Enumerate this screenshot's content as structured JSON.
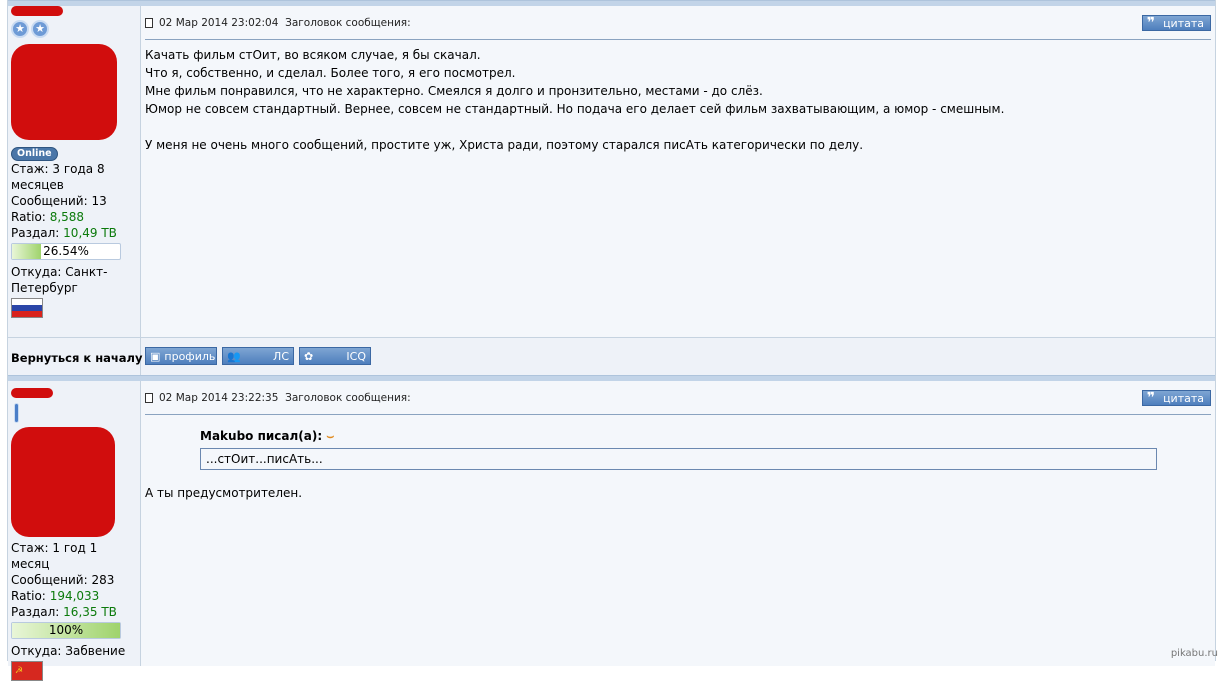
{
  "post1": {
    "author": {
      "online_label": "Online",
      "stats": {
        "tenure_label": "Стаж: 3 года 8",
        "tenure_cont": "месяцев",
        "messages_label": "Сообщений: 13",
        "ratio_label": "Ratio:",
        "ratio_value": "8,588",
        "upload_label": "Раздал:",
        "upload_value": "10,49 TB",
        "progress_text": "26.54%",
        "progress_fraction": 0.2654,
        "from_label": "Откуда: Санкт-",
        "from_cont": "Петербург"
      },
      "flag": "russia-flag-icon"
    },
    "header": {
      "date": "02 Мар 2014 23:02:04",
      "subject_label": "Заголовок сообщения:",
      "quote_label": "цитата"
    },
    "lines": [
      "Качать фильм стОит, во всяком случае, я бы скачал.",
      "Что я, собственно, и сделал. Более того, я его посмотрел.",
      "Мне фильм понравился, что не характерно. Смеялся я долго и пронзительно, местами - до слёз.",
      "Юмор не совсем стандартный. Вернее, совсем не стандартный. Но подача его делает сей фильм захватывающим, а юмор - смешным.",
      "",
      "У меня не очень много сообщений, простите уж, Христа ради, поэтому старался писАть категорически по делу."
    ],
    "footer": {
      "back_to_top": "Вернуться к началу",
      "profile": "профиль",
      "pm": "ЛС",
      "icq": "ICQ"
    }
  },
  "post2": {
    "author": {
      "stats": {
        "tenure_label": "Стаж: 1 год 1 месяц",
        "messages_label": "Сообщений: 283",
        "ratio_label": "Ratio:",
        "ratio_value": "194,033",
        "upload_label": "Раздал:",
        "upload_value": "16,35 TB",
        "progress_text": "100%",
        "progress_fraction": 1.0,
        "from_label": "Откуда: Забвение"
      },
      "flag": "ussr-flag-icon"
    },
    "header": {
      "date": "02 Мар 2014 23:22:35",
      "subject_label": "Заголовок сообщения:",
      "quote_label": "цитата"
    },
    "quote": {
      "author": "Makubo писал(а):",
      "text": "...стОит...писАть..."
    },
    "reply": "А ты предусмотрителен."
  },
  "watermark": "pikabu.ru",
  "colors": {
    "redaction": "#d10d0d",
    "accent_button": "#4e7fbd",
    "stat_green": "#0b7a0b"
  }
}
